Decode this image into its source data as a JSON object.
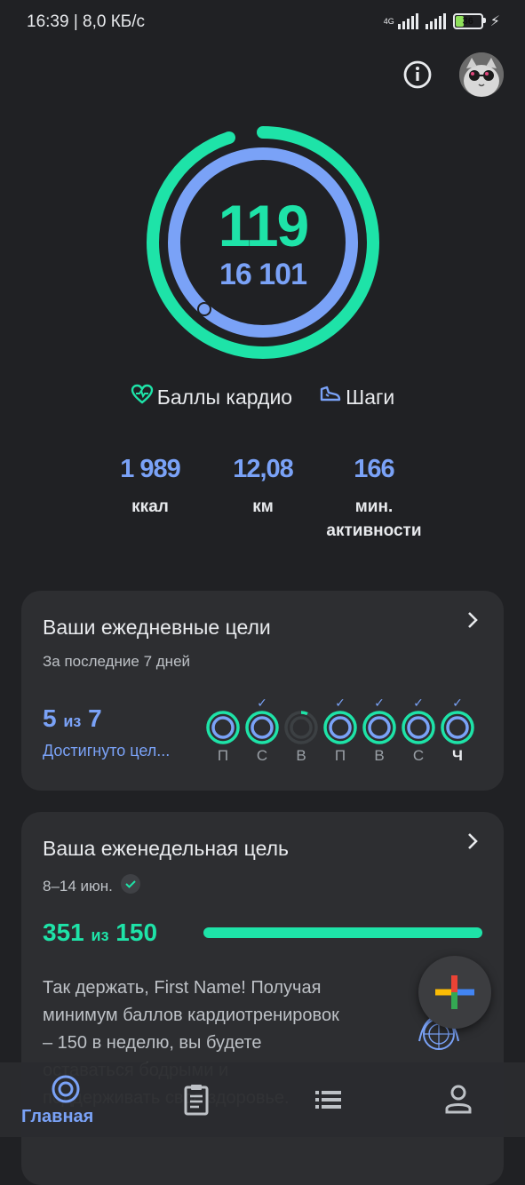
{
  "status_bar": {
    "time_speed": "16:39 | 8,0 КБ/с",
    "network_type": "4G",
    "battery_level": "36",
    "battery_percent": 36,
    "icons": [
      "signal-icon",
      "signal-icon",
      "battery-icon",
      "charging-icon"
    ]
  },
  "header": {
    "icons": [
      "info-icon",
      "avatar"
    ]
  },
  "ring": {
    "primary_value": "119",
    "secondary_value": "16 101",
    "outer_fraction": 0.95,
    "inner_fraction": 1.0,
    "colors": {
      "outer": "#1ee3a8",
      "inner": "#7aa2f7"
    }
  },
  "legend": {
    "cardio_label": "Баллы кардио",
    "steps_label": "Шаги",
    "icons": [
      "heart-icon",
      "shoe-icon"
    ]
  },
  "stats": [
    {
      "value": "1 989",
      "label": "ккал"
    },
    {
      "value": "12,08",
      "label": "км"
    },
    {
      "value": "166",
      "label_line1": "мин.",
      "label_line2": "активности"
    }
  ],
  "daily_goals": {
    "title": "Ваши ежедневные цели",
    "subtitle": "За последние 7 дней",
    "achieved": "5",
    "of_label": "из",
    "total": "7",
    "link": "Достигнуто цел...",
    "days": [
      {
        "label": "П",
        "checked": false,
        "completed": true
      },
      {
        "label": "С",
        "checked": true,
        "completed": true
      },
      {
        "label": "В",
        "checked": false,
        "completed": false
      },
      {
        "label": "П",
        "checked": true,
        "completed": true
      },
      {
        "label": "В",
        "checked": true,
        "completed": true
      },
      {
        "label": "С",
        "checked": true,
        "completed": true
      },
      {
        "label": "Ч",
        "checked": true,
        "completed": true,
        "today": true
      }
    ]
  },
  "weekly_goal": {
    "title": "Ваша еженедельная цель",
    "date_range": "8–14 июн.",
    "achieved": "351",
    "of_label": "из",
    "target": "150",
    "progress_fraction": 1.0,
    "message": "Так держать, First Name! Получая минимум баллов кардиотренировок – 150 в неделю, вы будете оставаться бодрыми и поддерживать свое здоровье."
  },
  "fab": {
    "icon": "plus-icon"
  },
  "bottom_nav": {
    "home_label": "Главная",
    "icons": [
      "home-ring-icon",
      "clipboard-icon",
      "list-icon",
      "profile-icon"
    ]
  },
  "colors": {
    "background": "#202124",
    "card": "#2d2e31",
    "green_accent": "#1ee3a8",
    "blue_accent": "#7aa2f7"
  }
}
